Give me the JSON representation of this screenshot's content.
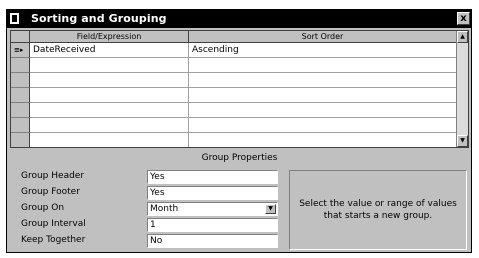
{
  "window": {
    "title": "Sorting and Grouping",
    "close_glyph": "x"
  },
  "grid": {
    "columns": [
      "Field/Expression",
      "Sort Order"
    ],
    "rows": [
      {
        "field": "DateReceived",
        "sort": "Ascending",
        "marker": "≡▸"
      },
      {
        "field": "",
        "sort": ""
      },
      {
        "field": "",
        "sort": ""
      },
      {
        "field": "",
        "sort": ""
      },
      {
        "field": "",
        "sort": ""
      },
      {
        "field": "",
        "sort": ""
      },
      {
        "field": "",
        "sort": ""
      }
    ],
    "scroll_up_glyph": "▲",
    "scroll_down_glyph": "▼"
  },
  "group_properties": {
    "title": "Group Properties",
    "items": [
      {
        "label": "Group Header",
        "value": "Yes"
      },
      {
        "label": "Group Footer",
        "value": "Yes"
      },
      {
        "label": "Group On",
        "value": "Month",
        "dropdown": true
      },
      {
        "label": "Group Interval",
        "value": "1"
      },
      {
        "label": "Keep Together",
        "value": "No"
      }
    ],
    "dropdown_glyph": "▼",
    "help_text": "Select the value or range of values that starts a new group."
  }
}
